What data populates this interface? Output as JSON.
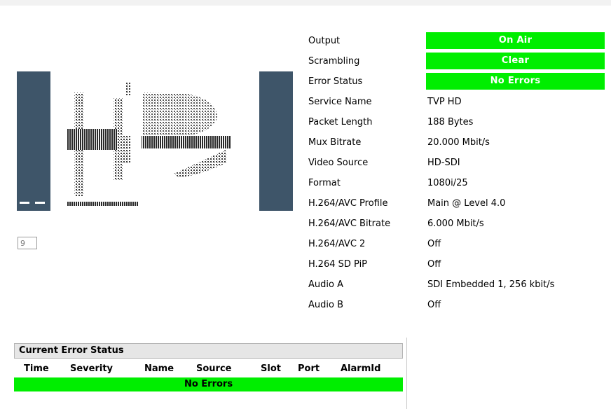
{
  "preview": {
    "channel_number": "9"
  },
  "status": {
    "output": {
      "label": "Output",
      "value": "On Air"
    },
    "scrambling": {
      "label": "Scrambling",
      "value": "Clear"
    },
    "error_status": {
      "label": "Error Status",
      "value": "No Errors"
    },
    "badge_color": "#00ee00"
  },
  "details": [
    {
      "label": "Service Name",
      "value": "TVP HD"
    },
    {
      "label": "Packet Length",
      "value": "188 Bytes"
    },
    {
      "label": "Mux Bitrate",
      "value": "20.000 Mbit/s"
    },
    {
      "label": "Video Source",
      "value": "HD-SDI"
    },
    {
      "label": "Format",
      "value": "1080i/25"
    },
    {
      "label": "H.264/AVC Profile",
      "value": "Main @ Level 4.0"
    },
    {
      "label": "H.264/AVC Bitrate",
      "value": "6.000 Mbit/s"
    },
    {
      "label": "H.264/AVC 2",
      "value": "Off"
    },
    {
      "label": "H.264 SD PiP",
      "value": "Off"
    },
    {
      "label": "Audio A",
      "value": "SDI Embedded 1, 256 kbit/s"
    },
    {
      "label": "Audio B",
      "value": "Off"
    }
  ],
  "error_panel": {
    "title": "Current Error Status",
    "columns": [
      "Time",
      "Severity",
      "Name",
      "Source",
      "Slot",
      "Port",
      "AlarmId"
    ],
    "status": "No Errors"
  },
  "colors": {
    "ok_green": "#00ee00",
    "preview_bar": "#3e5569"
  }
}
